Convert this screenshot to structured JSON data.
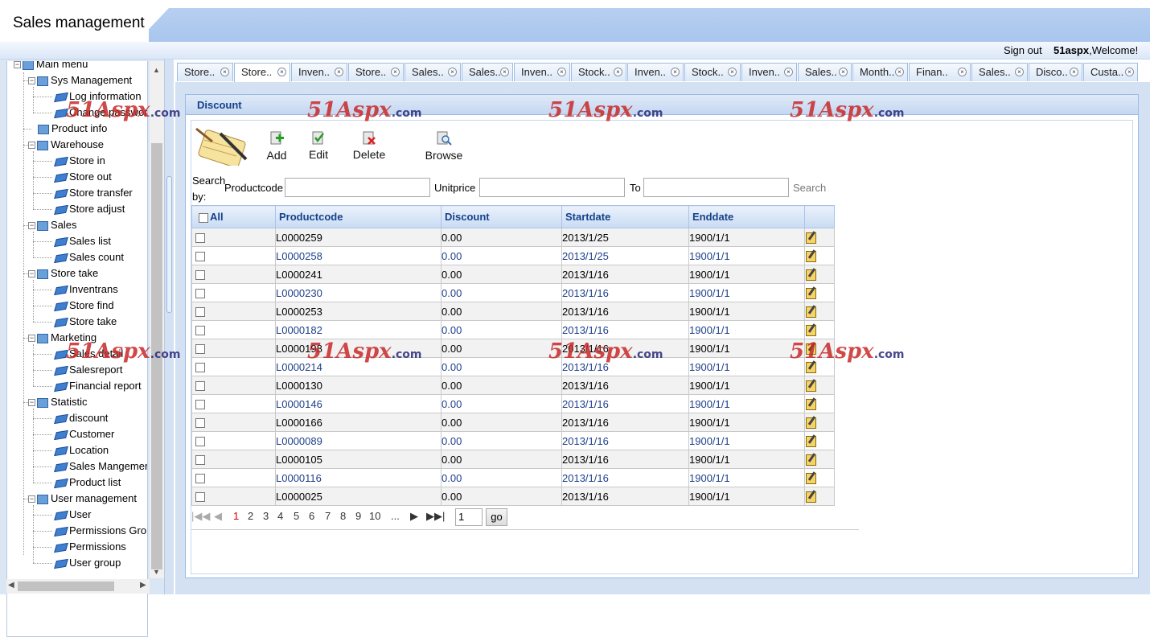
{
  "app": {
    "title": "Sales management"
  },
  "topbar": {
    "signout": "Sign out",
    "user": "51aspx",
    "welcome": ",Welcome!"
  },
  "tree": {
    "root": "Main menu",
    "groups": [
      {
        "label": "Sys Management",
        "items": [
          "Log information",
          "Change password"
        ]
      },
      {
        "label": "Product info",
        "items": []
      },
      {
        "label": "Warehouse",
        "items": [
          "Store in",
          "Store out",
          "Store transfer",
          "Store adjust"
        ]
      },
      {
        "label": "Sales",
        "items": [
          "Sales list",
          "Sales count"
        ]
      },
      {
        "label": "Store take",
        "items": [
          "Inventrans",
          "Store find",
          "Store take"
        ]
      },
      {
        "label": "Marketing",
        "items": [
          "Sales detail",
          "Salesreport",
          "Financial report"
        ]
      },
      {
        "label": "Statistic",
        "items": [
          "discount",
          "Customer",
          "Location",
          "Sales Mangement",
          "Product list"
        ]
      },
      {
        "label": "User management",
        "items": [
          "User",
          "Permissions Group",
          "Permissions",
          "User group"
        ]
      }
    ]
  },
  "tabs": [
    "Store..",
    "Store..",
    "Inven..",
    "Store..",
    "Sales..",
    "Sales..",
    "Inven..",
    "Stock..",
    "Inven..",
    "Stock..",
    "Inven..",
    "Sales..",
    "Month..",
    "Finan..",
    "Sales..",
    "Disco..",
    "Custa.."
  ],
  "panel": {
    "title": "Discount"
  },
  "toolbar": {
    "add": "Add",
    "edit": "Edit",
    "delete": "Delete",
    "browse": "Browse"
  },
  "search": {
    "label": "Search by:",
    "productcode": "Productcode",
    "unitprice": "Unitprice",
    "to": "To",
    "button": "Search",
    "productcode_value": "",
    "unitprice_from": "",
    "unitprice_to": ""
  },
  "grid": {
    "columns": [
      "All",
      "Productcode",
      "Discount",
      "Startdate",
      "Enddate"
    ],
    "rows": [
      {
        "code": "L0000259",
        "discount": "0.00",
        "start": "2013/1/25",
        "end": "1900/1/1"
      },
      {
        "code": "L0000258",
        "discount": "0.00",
        "start": "2013/1/25",
        "end": "1900/1/1"
      },
      {
        "code": "L0000241",
        "discount": "0.00",
        "start": "2013/1/16",
        "end": "1900/1/1"
      },
      {
        "code": "L0000230",
        "discount": "0.00",
        "start": "2013/1/16",
        "end": "1900/1/1"
      },
      {
        "code": "L0000253",
        "discount": "0.00",
        "start": "2013/1/16",
        "end": "1900/1/1"
      },
      {
        "code": "L0000182",
        "discount": "0.00",
        "start": "2013/1/16",
        "end": "1900/1/1"
      },
      {
        "code": "L0000198",
        "discount": "0.00",
        "start": "2013/1/16",
        "end": "1900/1/1"
      },
      {
        "code": "L0000214",
        "discount": "0.00",
        "start": "2013/1/16",
        "end": "1900/1/1"
      },
      {
        "code": "L0000130",
        "discount": "0.00",
        "start": "2013/1/16",
        "end": "1900/1/1"
      },
      {
        "code": "L0000146",
        "discount": "0.00",
        "start": "2013/1/16",
        "end": "1900/1/1"
      },
      {
        "code": "L0000166",
        "discount": "0.00",
        "start": "2013/1/16",
        "end": "1900/1/1"
      },
      {
        "code": "L0000089",
        "discount": "0.00",
        "start": "2013/1/16",
        "end": "1900/1/1"
      },
      {
        "code": "L0000105",
        "discount": "0.00",
        "start": "2013/1/16",
        "end": "1900/1/1"
      },
      {
        "code": "L0000116",
        "discount": "0.00",
        "start": "2013/1/16",
        "end": "1900/1/1"
      },
      {
        "code": "L0000025",
        "discount": "0.00",
        "start": "2013/1/16",
        "end": "1900/1/1"
      }
    ]
  },
  "pager": {
    "pages": [
      "1",
      "2",
      "3",
      "4",
      "5",
      "6",
      "7",
      "8",
      "9",
      "10",
      "..."
    ],
    "current": "1",
    "input": "1",
    "go": "go"
  },
  "watermark": {
    "text": "51Aspx",
    "suffix": ".com"
  }
}
